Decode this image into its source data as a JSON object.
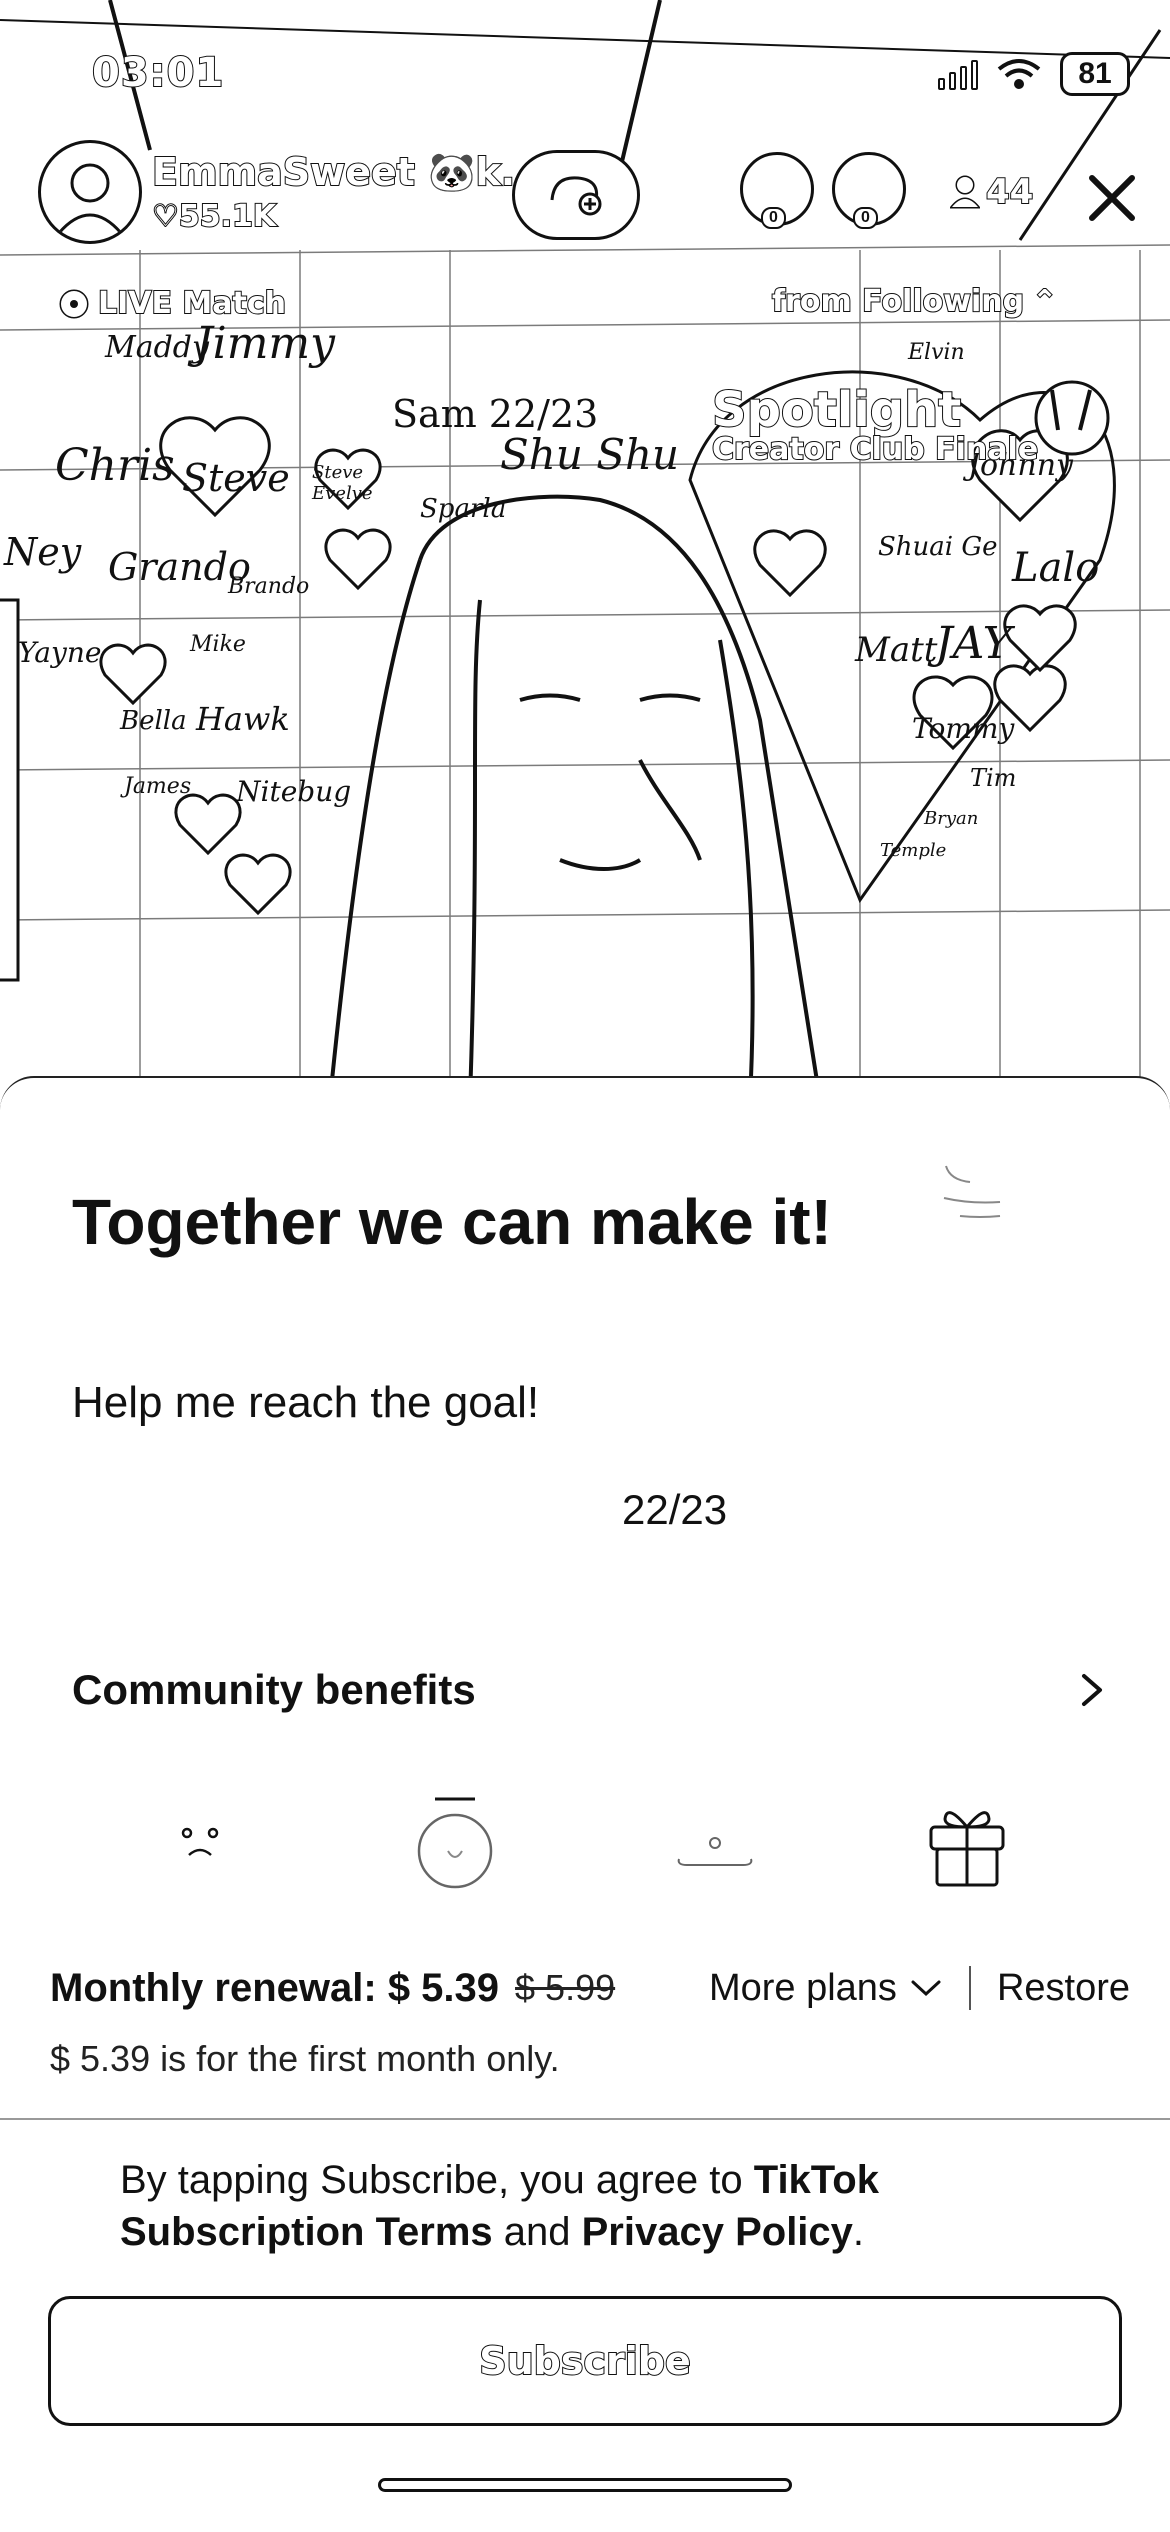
{
  "status_bar": {
    "time": "03:01",
    "battery": "81"
  },
  "host": {
    "name": "EmmaSweet 🐼k...",
    "likes": "55.1K"
  },
  "viewers": {
    "avatar_counts": [
      "0",
      "0"
    ],
    "count": "44"
  },
  "overlay": {
    "live_match": "LIVE Match",
    "from_following": "from Following",
    "spotlight": "Spotlight",
    "spotlight_sub": "Creator Club Finale",
    "wall_counter": "Sam 22/23"
  },
  "wall_names": [
    "Maddy",
    "Jimmy",
    "Chris",
    "Steve",
    "Steve Evelve",
    "Ney",
    "Grando",
    "Brando",
    "Yayne",
    "Mike",
    "Bella",
    "Hawk",
    "James",
    "Nitebug",
    "Sparla",
    "Shu Shu",
    "Elvin",
    "Johnny",
    "Lalo",
    "JAY",
    "Matt",
    "Tommy",
    "Tim",
    "Bryan",
    "Temple",
    "Shuai Ge"
  ],
  "goal": {
    "title": "Together we can make it!",
    "subtitle": "Help me reach the goal!",
    "progress": "22/23"
  },
  "benefits": {
    "title": "Community benefits"
  },
  "pricing": {
    "label": "Monthly renewal: $ 5.39",
    "original": "$ 5.99",
    "more_plans": "More plans",
    "restore": "Restore",
    "note": "$ 5.39 is for the first month only."
  },
  "terms": {
    "prefix": "By tapping Subscribe, you agree to ",
    "tiktok_terms": "TikTok Subscription Terms",
    "and": " and ",
    "privacy": "Privacy Policy",
    "suffix": "."
  },
  "subscribe_button": "Subscribe"
}
